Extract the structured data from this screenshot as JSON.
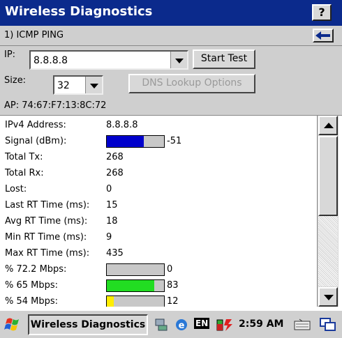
{
  "window": {
    "title": "Wireless Diagnostics",
    "help_label": "?"
  },
  "section": {
    "title": "1) ICMP PING"
  },
  "form": {
    "ip_label": "IP:",
    "ip_value": "8.8.8.8",
    "start_label": "Start Test",
    "size_label": "Size:",
    "size_value": "32",
    "dns_label": "DNS Lookup Options",
    "ap_text": "AP: 74:67:F7:13:8C:72"
  },
  "results": [
    {
      "label": "IPv4 Address:",
      "value": "8.8.8.8"
    },
    {
      "label": "Signal (dBm):",
      "value": "-51",
      "bar_fraction": 0.65,
      "bar_color": "#0000cc"
    },
    {
      "label": "Total Tx:",
      "value": "268"
    },
    {
      "label": "Total Rx:",
      "value": "268"
    },
    {
      "label": "Lost:",
      "value": "0"
    },
    {
      "label": "Last RT Time (ms):",
      "value": "15"
    },
    {
      "label": "Avg RT Time (ms):",
      "value": "18"
    },
    {
      "label": "Min RT Time (ms):",
      "value": "9"
    },
    {
      "label": "Max RT Time (ms):",
      "value": "435"
    },
    {
      "label": "% 72.2 Mbps:",
      "value": "0",
      "bar_fraction": 0.0,
      "bar_color": "#00cc00"
    },
    {
      "label": "% 65 Mbps:",
      "value": "83",
      "bar_fraction": 0.83,
      "bar_color": "#22dd22"
    },
    {
      "label": "% 54 Mbps:",
      "value": "12",
      "bar_fraction": 0.12,
      "bar_color": "#ffee00"
    }
  ],
  "taskbar": {
    "task_label": "Wireless Diagnostics",
    "lang": "EN",
    "clock": "2:59 AM"
  }
}
